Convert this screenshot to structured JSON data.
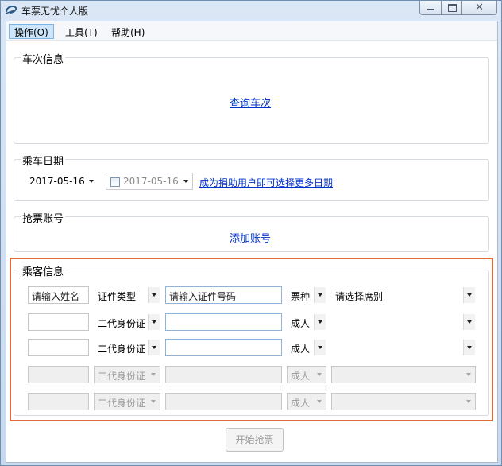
{
  "window": {
    "title": "车票无忧个人版",
    "close_glyph": "✕"
  },
  "menu": {
    "items": [
      {
        "label": "操作(O)"
      },
      {
        "label": "工具(T)"
      },
      {
        "label": "帮助(H)"
      }
    ]
  },
  "train_info": {
    "title": "车次信息",
    "query_link": "查询车次"
  },
  "ride_date": {
    "title": "乘车日期",
    "date": "2017-05-16",
    "extra_date": "2017-05-16",
    "upgrade_link": "成为捐助用户即可选择更多日期"
  },
  "accounts": {
    "title": "抢票账号",
    "add_link": "添加账号"
  },
  "passengers": {
    "title": "乘客信息",
    "rows": [
      {
        "name": "请输入姓名",
        "id_type": "证件类型",
        "id_number": "请输入证件号码",
        "ticket_type": "票种",
        "seat": "请选择席别"
      },
      {
        "name": "",
        "id_type": "二代身份证",
        "id_number": "",
        "ticket_type": "成人",
        "seat": ""
      },
      {
        "name": "",
        "id_type": "二代身份证",
        "id_number": "",
        "ticket_type": "成人",
        "seat": ""
      },
      {
        "name": "",
        "id_type": "二代身份证",
        "id_number": "",
        "ticket_type": "成人",
        "seat": ""
      },
      {
        "name": "",
        "id_type": "二代身份证",
        "id_number": "",
        "ticket_type": "成人",
        "seat": ""
      }
    ]
  },
  "actions": {
    "start_label": "开始抢票"
  },
  "colors": {
    "highlight": "#e06a3a",
    "link": "#0033cc"
  }
}
